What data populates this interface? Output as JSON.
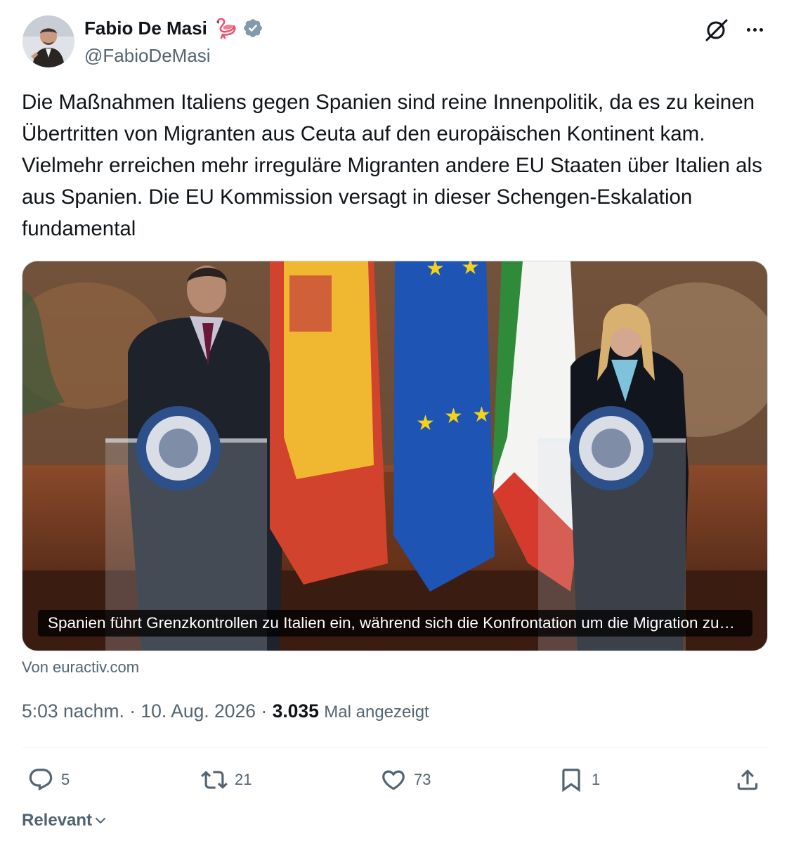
{
  "author": {
    "display_name": "Fabio De Masi",
    "handle": "@FabioDeMasi",
    "name_emoji": "flamingo-emoji",
    "verified_icon": "verified-badge-icon"
  },
  "tweet": {
    "text": "Die Maßnahmen Italiens gegen Spanien sind reine Innenpolitik, da es zu keinen Übertritten von Migranten aus Ceuta auf den europäischen Kontinent kam. Vielmehr erreichen mehr irreguläre Migranten andere EU Staaten über Italien als aus Spanien. Die EU Kommission versagt in dieser Schengen-Eskalation fundamental"
  },
  "card": {
    "caption": "Spanien führt Grenzkontrollen zu Italien ein, während sich die Konfrontation um die Migration zuspitzt",
    "source": "Von euractiv.com"
  },
  "meta": {
    "time": "5:03 nachm.",
    "separator": "·",
    "date": "10. Aug. 2026",
    "views_count": "3.035",
    "views_label": "Mal angezeigt"
  },
  "actions": {
    "replies": "5",
    "reposts": "21",
    "likes": "73",
    "bookmarks": "1"
  },
  "sort": {
    "label": "Relevant"
  },
  "colors": {
    "text_primary": "#0f1419",
    "text_secondary": "#536471",
    "verified": "#829aab",
    "divider": "#eff3f4"
  }
}
